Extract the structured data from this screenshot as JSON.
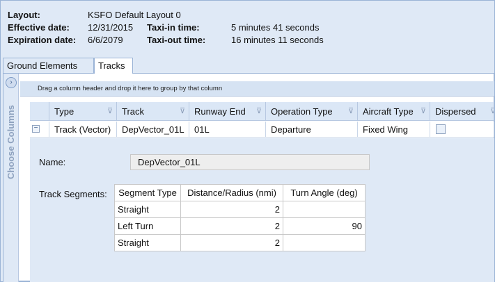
{
  "layout": {
    "layout_label": "Layout:",
    "layout_value": "KSFO Default Layout 0",
    "effective_label": "Effective date:",
    "effective_value": "12/31/2015",
    "expiration_label": "Expiration date:",
    "expiration_value": "6/6/2079",
    "taxi_in_label": "Taxi-in time:",
    "taxi_in_value": "5 minutes 41 seconds",
    "taxi_out_label": "Taxi-out time:",
    "taxi_out_value": "16 minutes 11 seconds"
  },
  "tabs": [
    {
      "label": "Ground Elements"
    },
    {
      "label": "Tracks"
    }
  ],
  "chooser": {
    "label": "Choose Columns",
    "icon": "chevron-right-icon"
  },
  "group_panel": {
    "text": "Drag a column header and drop it here to group by that column"
  },
  "columns": [
    "Type",
    "Track",
    "Runway End",
    "Operation Type",
    "Aircraft Type",
    "Dispersed"
  ],
  "row": {
    "type": "Track (Vector)",
    "track": "DepVector_01L",
    "runway_end": "01L",
    "operation_type": "Departure",
    "aircraft_type": "Fixed Wing",
    "expander": "⊟"
  },
  "detail": {
    "name_label": "Name:",
    "name_value": "DepVector_01L",
    "segments_label": "Track Segments:",
    "seg_headers": [
      "Segment Type",
      "Distance/Radius (nmi)",
      "Turn Angle (deg)"
    ],
    "segments": [
      {
        "type": "Straight",
        "distance": "2",
        "angle": ""
      },
      {
        "type": "Left Turn",
        "distance": "2",
        "angle": "90"
      },
      {
        "type": "Straight",
        "distance": "2",
        "angle": ""
      }
    ]
  },
  "colors": {
    "panel": "#dfe9f6",
    "border": "#9ab3d6",
    "header": "#dbe7f6"
  }
}
